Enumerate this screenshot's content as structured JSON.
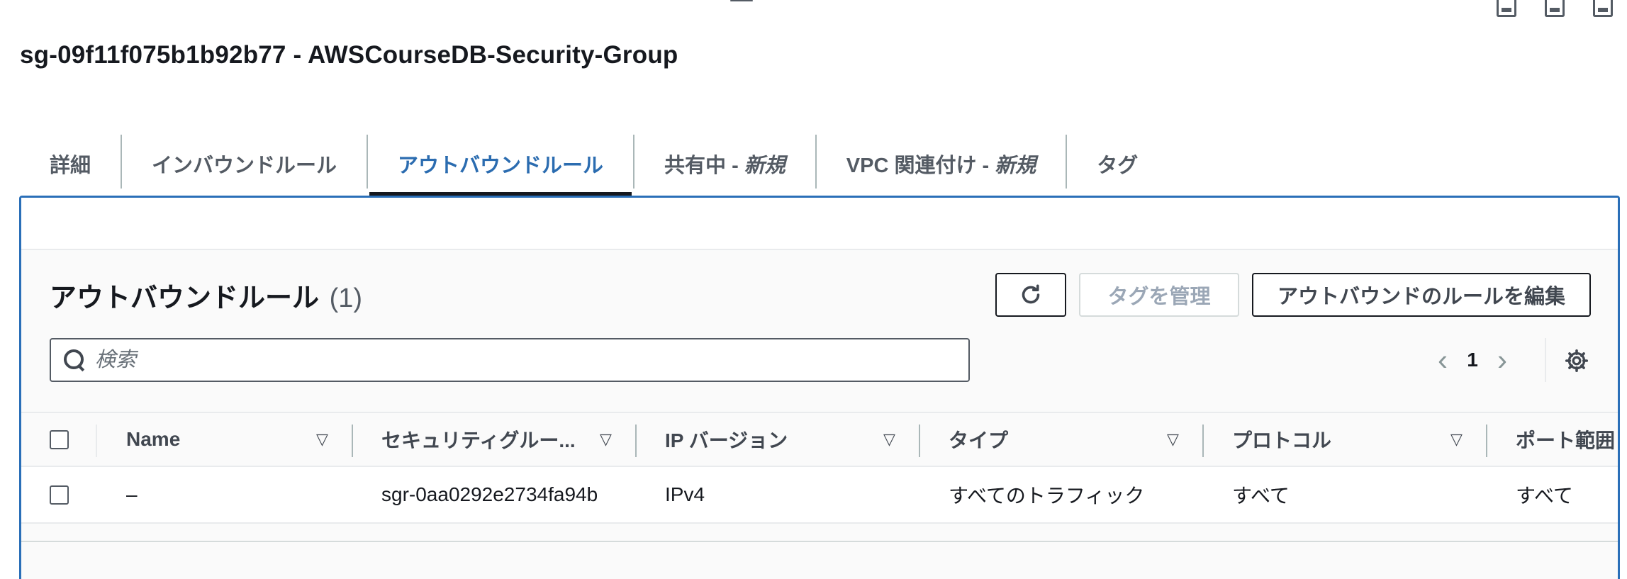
{
  "page": {
    "title": "sg-09f11f075b1b92b77 - AWSCourseDB-Security-Group"
  },
  "tabs": [
    {
      "label": "詳細",
      "new": ""
    },
    {
      "label": "インバウンドルール",
      "new": ""
    },
    {
      "label": "アウトバウンドルール",
      "new": ""
    },
    {
      "label": "共有中 - ",
      "new": "新規"
    },
    {
      "label": "VPC 関連付け - ",
      "new": "新規"
    },
    {
      "label": "タグ",
      "new": ""
    }
  ],
  "active_tab": "アウトバウンドルール",
  "section": {
    "title": "アウトバウンドルール",
    "count": "(1)"
  },
  "actions": {
    "refresh_icon": "refresh-icon",
    "manage_tags_label": "タグを管理",
    "edit_label": "アウトバウンドのルールを編集"
  },
  "search": {
    "placeholder": "検索",
    "value": ""
  },
  "pagination": {
    "page": "1",
    "prev_glyph": "‹",
    "next_glyph": "›",
    "settings_icon": "gear-icon"
  },
  "table": {
    "columns": [
      "Name",
      "セキュリティグルー...",
      "IP バージョン",
      "タイプ",
      "プロトコル",
      "ポート範囲"
    ],
    "rows": [
      {
        "name": "–",
        "security_group_rule_id": "sgr-0aa0292e2734fa94b",
        "ip_version": "IPv4",
        "type": "すべてのトラフィック",
        "protocol": "すべて",
        "port_range": "すべて"
      }
    ]
  },
  "colors": {
    "accent_blue": "#2a6fb8",
    "text_dark": "#16191f",
    "border_light": "#e9ebed"
  }
}
